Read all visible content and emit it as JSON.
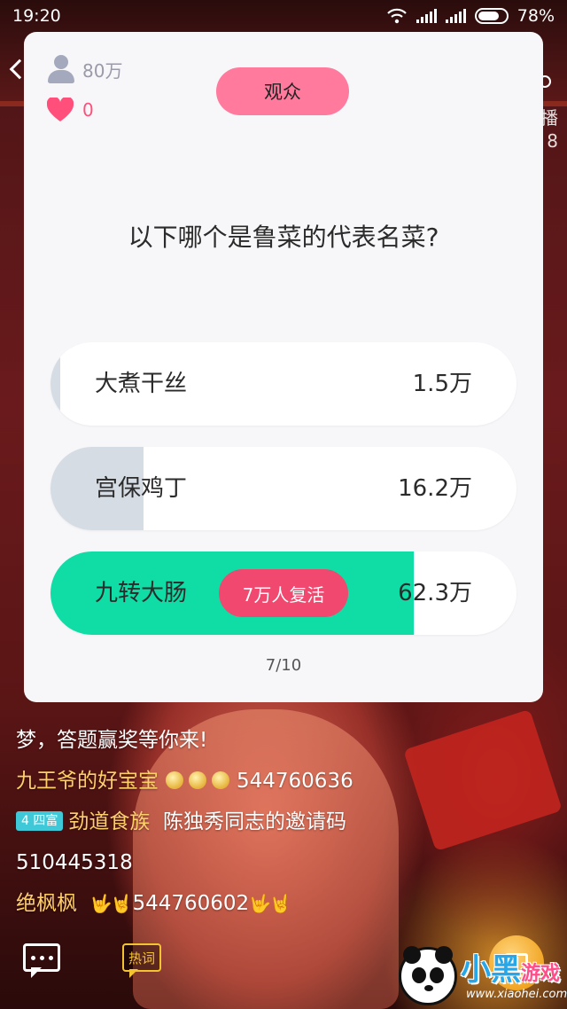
{
  "status_bar": {
    "time": "19:20",
    "battery": "78%"
  },
  "side_overlay": {
    "right_text_1": "播",
    "right_text_2": "8"
  },
  "quiz": {
    "viewer_count": "80万",
    "likes": "0",
    "role_label": "观众",
    "question": "以下哪个是鲁菜的代表名菜?",
    "options": [
      {
        "label": "大煮干丝",
        "count": "1.5万",
        "share": 0.02,
        "correct": false
      },
      {
        "label": "宫保鸡丁",
        "count": "16.2万",
        "share": 0.2,
        "correct": false
      },
      {
        "label": "九转大肠",
        "count": "62.3万",
        "share": 0.78,
        "correct": true
      }
    ],
    "revive_badge": "7万人复活",
    "progress": "7/10"
  },
  "chat": {
    "line1": "梦，答题赢奖等你来!",
    "line2_user": "九王爷的好宝宝",
    "line2_msg": "544760636",
    "line3_badge": "4 四富",
    "line3_user": "劲道食族",
    "line3_msg": "陈独秀同志的邀请码",
    "line4_msg": "510445318",
    "line5_user": "绝枫枫",
    "line5_msg": "544760602"
  },
  "bottom_bar": {
    "hotword_label": "热词"
  },
  "watermark": {
    "title_main": "小黑",
    "title_accent": "游戏",
    "url": "www.xiaohei.com"
  },
  "colors": {
    "card_bg": "#f7f7f9",
    "pill_pink": "#ff7a9d",
    "correct_green": "#10dca6",
    "wrong_fill": "#d6dce4",
    "revive_red": "#f0486e",
    "username_gold": "#ffcf6a"
  }
}
